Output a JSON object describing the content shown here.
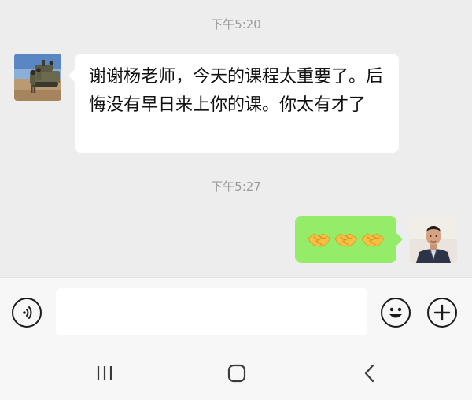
{
  "chat": {
    "timestamps": [
      "下午5:20",
      "下午5:27"
    ],
    "messages": [
      {
        "side": "left",
        "avatar": "avatar-soldier-photo",
        "text": "谢谢杨老师，今天的课程太重要了。后悔没有早日来上你的课。你太有才了"
      },
      {
        "side": "right",
        "avatar": "avatar-man-photo",
        "emojis": [
          "handshake-icon",
          "handshake-icon",
          "handshake-icon"
        ]
      }
    ]
  },
  "input_bar": {
    "voice_icon": "voice-icon",
    "text_value": "",
    "emoji_icon": "emoji-icon",
    "plus_icon": "plus-icon"
  },
  "nav_bar": {
    "recent_icon": "recent-apps-icon",
    "home_icon": "home-icon",
    "back_icon": "back-icon"
  },
  "colors": {
    "chat_background": "#ededed",
    "bubble_incoming": "#ffffff",
    "bubble_outgoing": "#95ec69",
    "timestamp_text": "#9b9b9b"
  }
}
